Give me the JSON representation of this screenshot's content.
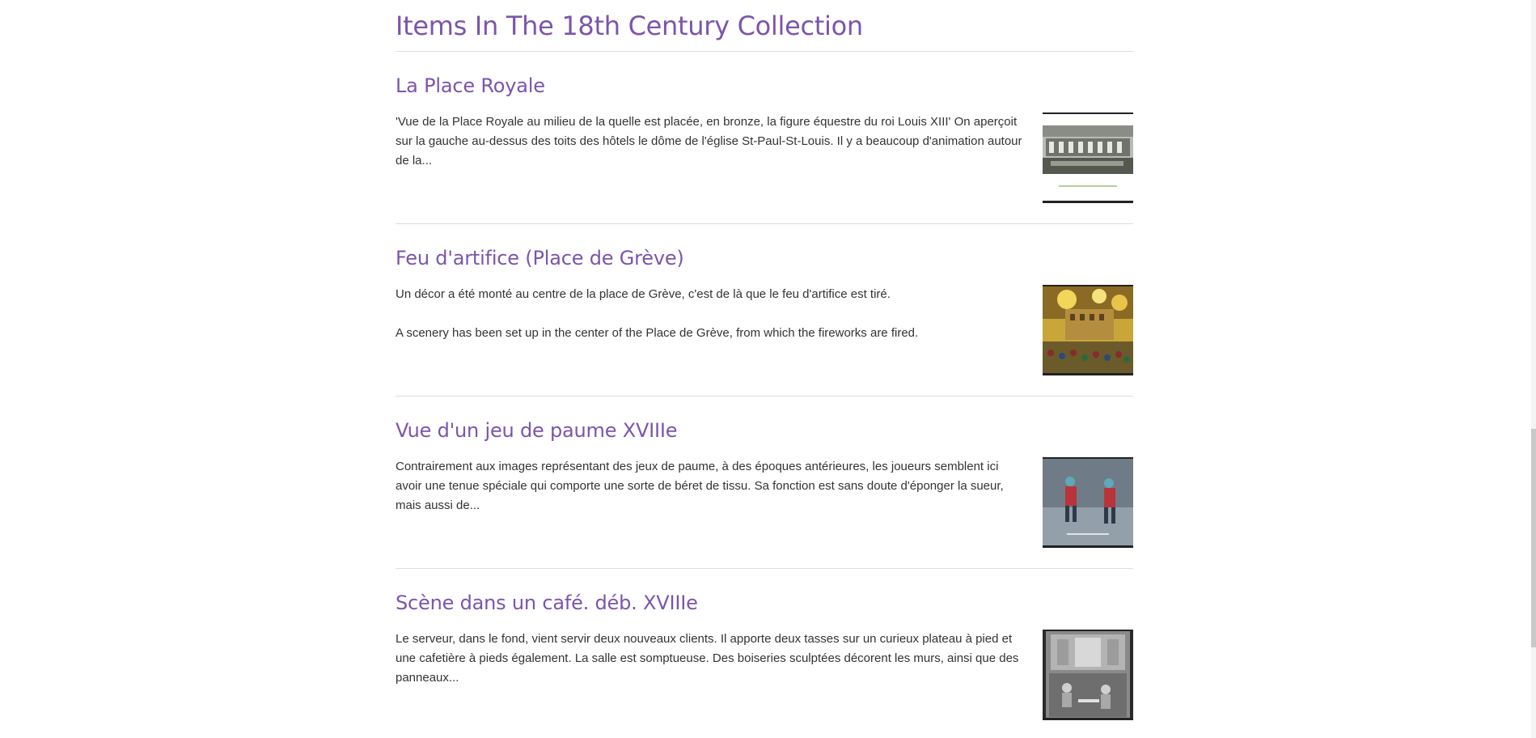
{
  "collection": {
    "title": "Items In The 18th Century Collection"
  },
  "items": [
    {
      "title": "La Place Royale",
      "paragraphs": [
        "'Vue de la Place Royale au milieu de la quelle est placée, en bronze, la figure équestre du roi Louis XIII' On aperçoit sur la gauche au-dessus des toits des hôtels le dôme de l'église St-Paul-St-Louis. Il y a beaucoup d'animation autour de la..."
      ],
      "thumbnail_icon": "engraving-thumbnail"
    },
    {
      "title": "Feu d'artifice (Place de Grève)",
      "paragraphs": [
        "Un décor a été monté au centre de la place de Grève, c'est de là que le feu d'artifice est tiré.",
        "A scenery has been set up in the center of the Place de Grève, from which the fireworks are fired."
      ],
      "thumbnail_icon": "fireworks-thumbnail"
    },
    {
      "title": "Vue d'un jeu de paume XVIIIe",
      "paragraphs": [
        "Contrairement aux images représentant des jeux de paume, à des époques antérieures, les joueurs semblent ici avoir une tenue spéciale qui comporte une sorte de béret de tissu. Sa fonction est sans doute d'éponger la sueur, mais aussi de..."
      ],
      "thumbnail_icon": "tennis-thumbnail"
    },
    {
      "title": "Scène dans un café. déb. XVIIIe",
      "paragraphs": [
        "Le serveur, dans le fond, vient servir deux nouveaux clients. Il apporte deux tasses sur un curieux plateau à pied et une cafetière à pieds également. La salle est somptueuse. Des boiseries sculptées décorent les murs, ainsi que des panneaux..."
      ],
      "thumbnail_icon": "cafe-thumbnail"
    }
  ],
  "colors": {
    "accent": "#7b55ab",
    "text": "#333333",
    "rule": "#dddddd"
  }
}
